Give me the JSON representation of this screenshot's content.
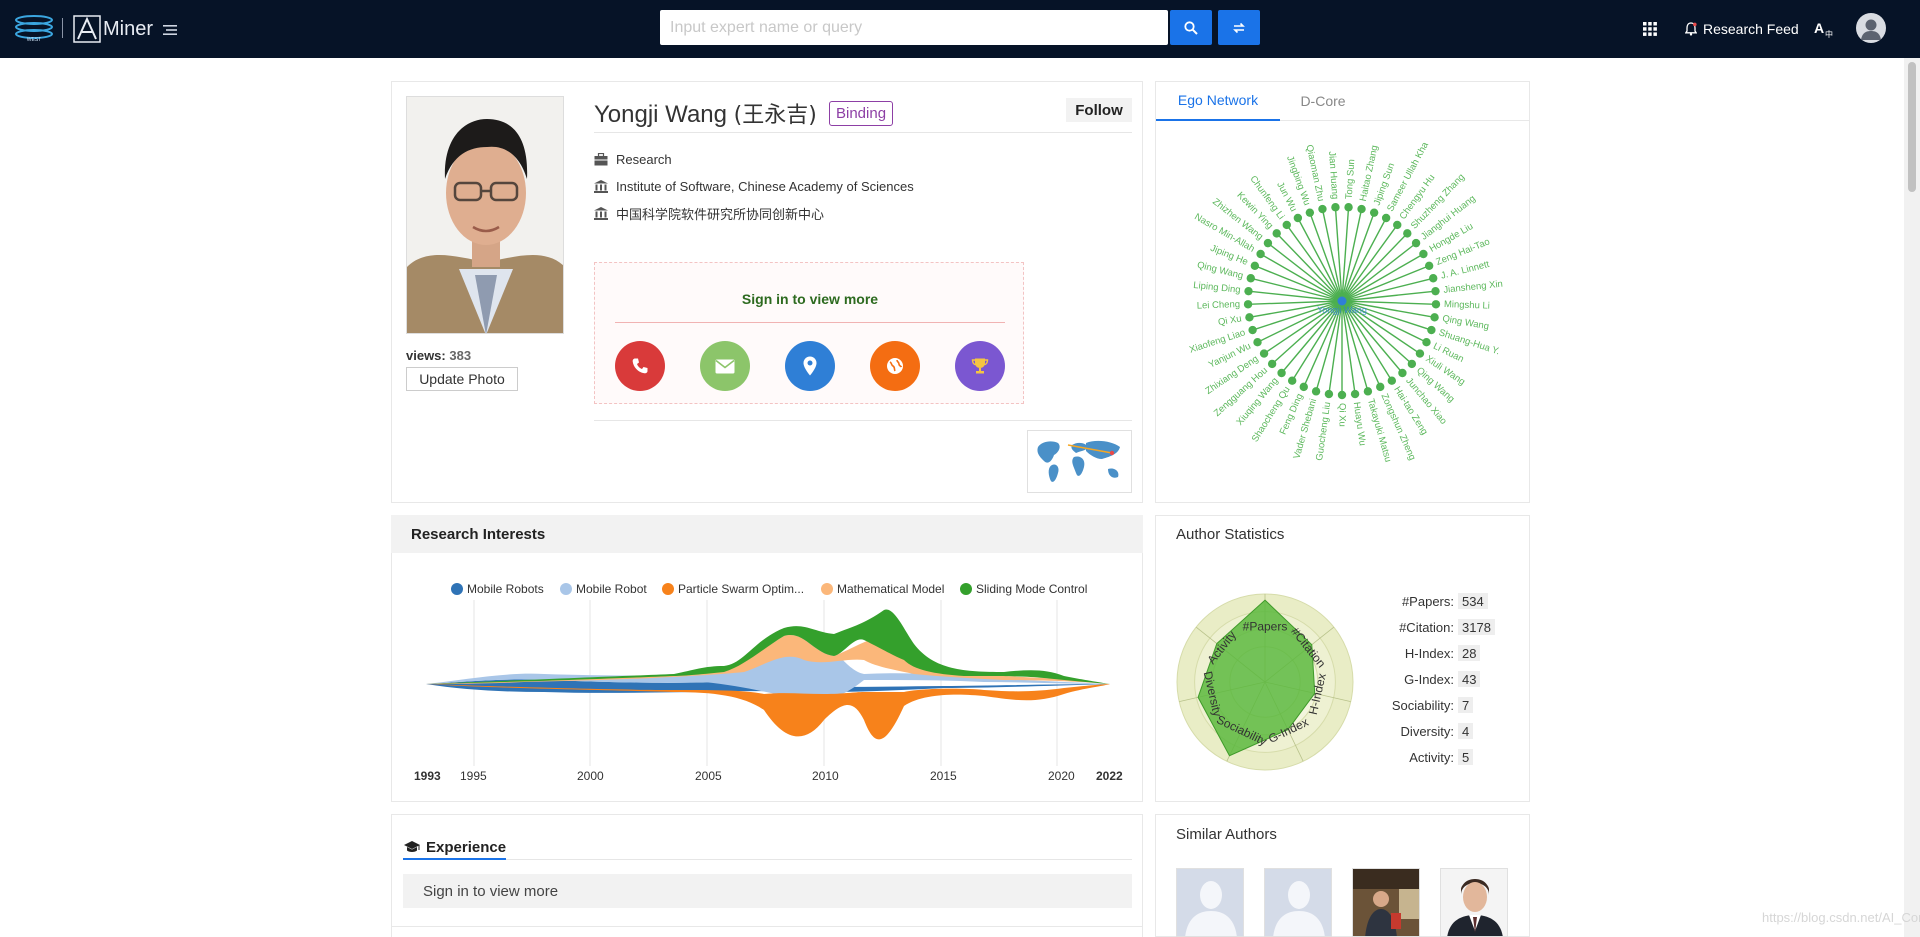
{
  "topbar": {
    "brand": "Miner",
    "search_placeholder": "Input expert name or query",
    "research_feed": "Research Feed",
    "icons": [
      "aminer-logo-icon",
      "menu-icon",
      "search-icon",
      "switch-icon",
      "apps-grid-icon",
      "bell-icon",
      "translate-icon",
      "user-avatar-icon"
    ]
  },
  "profile": {
    "name": "Yongji Wang",
    "name_cn": "(王永吉)",
    "binding_label": "Binding",
    "follow_label": "Follow",
    "field": "Research",
    "affiliation": "Institute of Software, Chinese Academy of Sciences",
    "affiliation_cn": "中国科学院软件研究所协同创新中心",
    "views_label": "views:",
    "views_count": "383",
    "update_photo_label": "Update Photo",
    "signin_text": "Sign in to view more",
    "contact_icons": [
      "phone-icon",
      "email-icon",
      "location-icon",
      "homepage-icon",
      "award-icon"
    ],
    "contact_colors": [
      "#d93a3a",
      "#8cc56a",
      "#2f7fd6",
      "#f46d12",
      "#7b57d1"
    ]
  },
  "ego_network": {
    "tabs": [
      "Ego Network",
      "D-Core"
    ],
    "center": "Yongji Wang",
    "nodes": [
      "Tong Sun",
      "Haitao Zhang",
      "Jiping Sun",
      "Sameer Ullah Kha",
      "Chengyu Hu",
      "Shuzheng Zhang",
      "Jianghui Huang",
      "Hongde Liu",
      "Zeng Hai-Tao",
      "J. A. Linnett",
      "Jiansheng Xin",
      "Mingshu Li",
      "Qing Wang",
      "Shuang-Hua Y.",
      "Li Ruan",
      "Xiuli Wang",
      "Qing Wang",
      "Junchao Xiao",
      "Hai-tao Zeng",
      "Zongshun Zheng",
      "Takayuki Matsu",
      "Huayu Wu",
      "Qi Xu",
      "Guocheng Liu",
      "Vader Shebani",
      "Feng Ding",
      "Shaocheng Qu",
      "Xiuqing Wang",
      "Zengguang Hou",
      "Zhixiang Deng",
      "Yanjun Wu",
      "Xiaofeng Liao",
      "Qi Xu",
      "Lei Cheng",
      "Liping Ding",
      "Qing Wang",
      "Jiping He",
      "Nasro Min-Allah",
      "Zhizhen Wang",
      "Kewin Ying",
      "Chunfeng Li",
      "Jun Wu",
      "Jingbing Wu",
      "Qiaoman Zhu",
      "Jian Huang"
    ],
    "colors": {
      "node": "#4caf50",
      "center": "#2f7fd6",
      "text": "#5cb85c"
    }
  },
  "research_interests": {
    "title": "Research Interests",
    "legend": [
      {
        "label": "Mobile Robots",
        "color": "#2f73b6"
      },
      {
        "label": "Mobile Robot",
        "color": "#a9c6e8"
      },
      {
        "label": "Particle Swarm Optim...",
        "color": "#f7821b"
      },
      {
        "label": "Mathematical Model",
        "color": "#fbb77a"
      },
      {
        "label": "Sliding Mode Control",
        "color": "#34a02c"
      }
    ],
    "years": [
      "1993",
      "1995",
      "2000",
      "2005",
      "2010",
      "2015",
      "2020",
      "2022"
    ]
  },
  "author_statistics": {
    "title": "Author Statistics",
    "axes": [
      "#Papers",
      "#Citation",
      "H-Index",
      "G-Index",
      "Sociability",
      "Diversity",
      "Activity"
    ],
    "rows": [
      {
        "label": "#Papers:",
        "value": "534"
      },
      {
        "label": "#Citation:",
        "value": "3178"
      },
      {
        "label": "H-Index:",
        "value": "28"
      },
      {
        "label": "G-Index:",
        "value": "43"
      },
      {
        "label": "Sociability:",
        "value": "7"
      },
      {
        "label": "Diversity:",
        "value": "4"
      },
      {
        "label": "Activity:",
        "value": "5"
      }
    ]
  },
  "experience": {
    "title": "Experience",
    "signin_text": "Sign in to view more"
  },
  "similar_authors": {
    "title": "Similar Authors"
  },
  "watermark": "https://blog.csdn.net/AI_Cont"
}
